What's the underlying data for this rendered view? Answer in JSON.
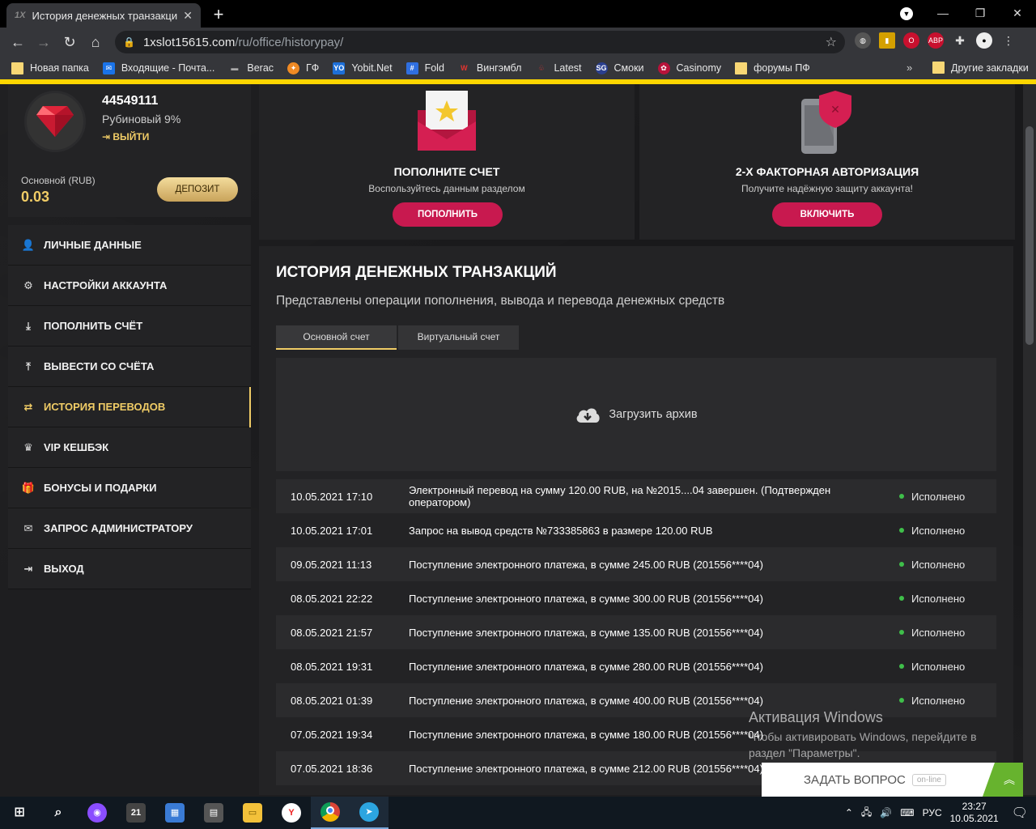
{
  "browser": {
    "tab_title": "История денежных транзакций",
    "tab_favicon": "1X",
    "url_host": "1xslot15615.com",
    "url_path": "/ru/office/historypay/",
    "bookmarks": [
      {
        "label": "Новая папка",
        "icon": "folder-icon"
      },
      {
        "label": "Входящие - Почта...",
        "icon": "mail-icon"
      },
      {
        "label": "Berac",
        "icon": "berac-icon"
      },
      {
        "label": "ГФ",
        "icon": "gf-icon"
      },
      {
        "label": "Yobit.Net",
        "icon": "yobit-icon"
      },
      {
        "label": "Fold",
        "icon": "fold-icon"
      },
      {
        "label": "Вингэмбл",
        "icon": "wingambl-icon"
      },
      {
        "label": "Latest",
        "icon": "latest-icon"
      },
      {
        "label": "Смоки",
        "icon": "smoki-icon"
      },
      {
        "label": "Casinomy",
        "icon": "casinomy-icon"
      },
      {
        "label": "форумы ПФ",
        "icon": "folder-icon"
      }
    ],
    "other_bookmarks": "Другие закладки",
    "more": "»"
  },
  "profile": {
    "user_id": "44549111",
    "rank": "Рубиновый 9%",
    "logout": "ВЫЙТИ",
    "balance_label": "Основной (RUB)",
    "balance_value": "0.03",
    "deposit_button": "ДЕПОЗИТ"
  },
  "menu": [
    {
      "label": "ЛИЧНЫЕ ДАННЫЕ",
      "icon": "user-icon",
      "glyph": "👤"
    },
    {
      "label": "НАСТРОЙКИ АККАУНТА",
      "icon": "settings-icon",
      "glyph": "⚙"
    },
    {
      "label": "ПОПОЛНИТЬ СЧЁТ",
      "icon": "download-icon",
      "glyph": "⤓"
    },
    {
      "label": "ВЫВЕСТИ СО СЧЁТА",
      "icon": "upload-icon",
      "glyph": "⤒"
    },
    {
      "label": "ИСТОРИЯ ПЕРЕВОДОВ",
      "icon": "transfer-icon",
      "glyph": "⇄"
    },
    {
      "label": "VIP КЕШБЭК",
      "icon": "crown-icon",
      "glyph": "♛"
    },
    {
      "label": "БОНУСЫ И ПОДАРКИ",
      "icon": "gift-icon",
      "glyph": "🎁"
    },
    {
      "label": "ЗАПРОС АДМИНИСТРАТОРУ",
      "icon": "envelope-icon",
      "glyph": "✉"
    },
    {
      "label": "ВЫХОД",
      "icon": "exit-icon",
      "glyph": "⇥"
    }
  ],
  "promo": {
    "deposit": {
      "title": "ПОПОЛНИТЕ СЧЕТ",
      "subtitle": "Воспользуйтесь данным разделом",
      "button": "ПОПОЛНИТЬ"
    },
    "twofa": {
      "title": "2-Х ФАКТОРНАЯ АВТОРИЗАЦИЯ",
      "subtitle": "Получите надёжную защиту аккаунта!",
      "button": "ВКЛЮЧИТЬ"
    }
  },
  "history": {
    "title": "ИСТОРИЯ ДЕНЕЖНЫХ ТРАНЗАКЦИЙ",
    "subtitle": "Представлены операции пополнения, вывода и перевода денежных средств",
    "tabs": [
      "Основной счет",
      "Виртуальный счет"
    ],
    "archive": "Загрузить архив",
    "rows": [
      {
        "date": "10.05.2021 17:10",
        "desc": "Электронный перевод на сумму 120.00 RUB, на №2015....04 завершен. (Подтвержден оператором)",
        "status": "Исполнено"
      },
      {
        "date": "10.05.2021 17:01",
        "desc": "Запрос на вывод средств №733385863 в размере 120.00 RUB",
        "status": "Исполнено"
      },
      {
        "date": "09.05.2021 11:13",
        "desc": "Поступление электронного платежа, в сумме 245.00 RUB (201556****04)",
        "status": "Исполнено"
      },
      {
        "date": "08.05.2021 22:22",
        "desc": "Поступление электронного платежа, в сумме 300.00 RUB (201556****04)",
        "status": "Исполнено"
      },
      {
        "date": "08.05.2021 21:57",
        "desc": "Поступление электронного платежа, в сумме 135.00 RUB (201556****04)",
        "status": "Исполнено"
      },
      {
        "date": "08.05.2021 19:31",
        "desc": "Поступление электронного платежа, в сумме 280.00 RUB (201556****04)",
        "status": "Исполнено"
      },
      {
        "date": "08.05.2021 01:39",
        "desc": "Поступление электронного платежа, в сумме 400.00 RUB (201556****04)",
        "status": "Исполнено"
      },
      {
        "date": "07.05.2021 19:34",
        "desc": "Поступление электронного платежа, в сумме 180.00 RUB (201556****04)",
        "status": ""
      },
      {
        "date": "07.05.2021 18:36",
        "desc": "Поступление электронного платежа, в сумме 212.00 RUB (201556****04)",
        "status": ""
      }
    ]
  },
  "overlay": {
    "activation_title": "Активация Windows",
    "activation_text": "Чтобы активировать Windows, перейдите в раздел \"Параметры\".",
    "ask_button": "ЗАДАТЬ ВОПРОС",
    "online_badge": "on-line"
  },
  "taskbar": {
    "language": "РУС",
    "time": "23:27",
    "date": "10.05.2021"
  },
  "colors": {
    "accent_gold": "#f0cc66",
    "accent_pink": "#c8194f",
    "status_green": "#3fbf4a",
    "browser_accent": "#fdd600"
  }
}
